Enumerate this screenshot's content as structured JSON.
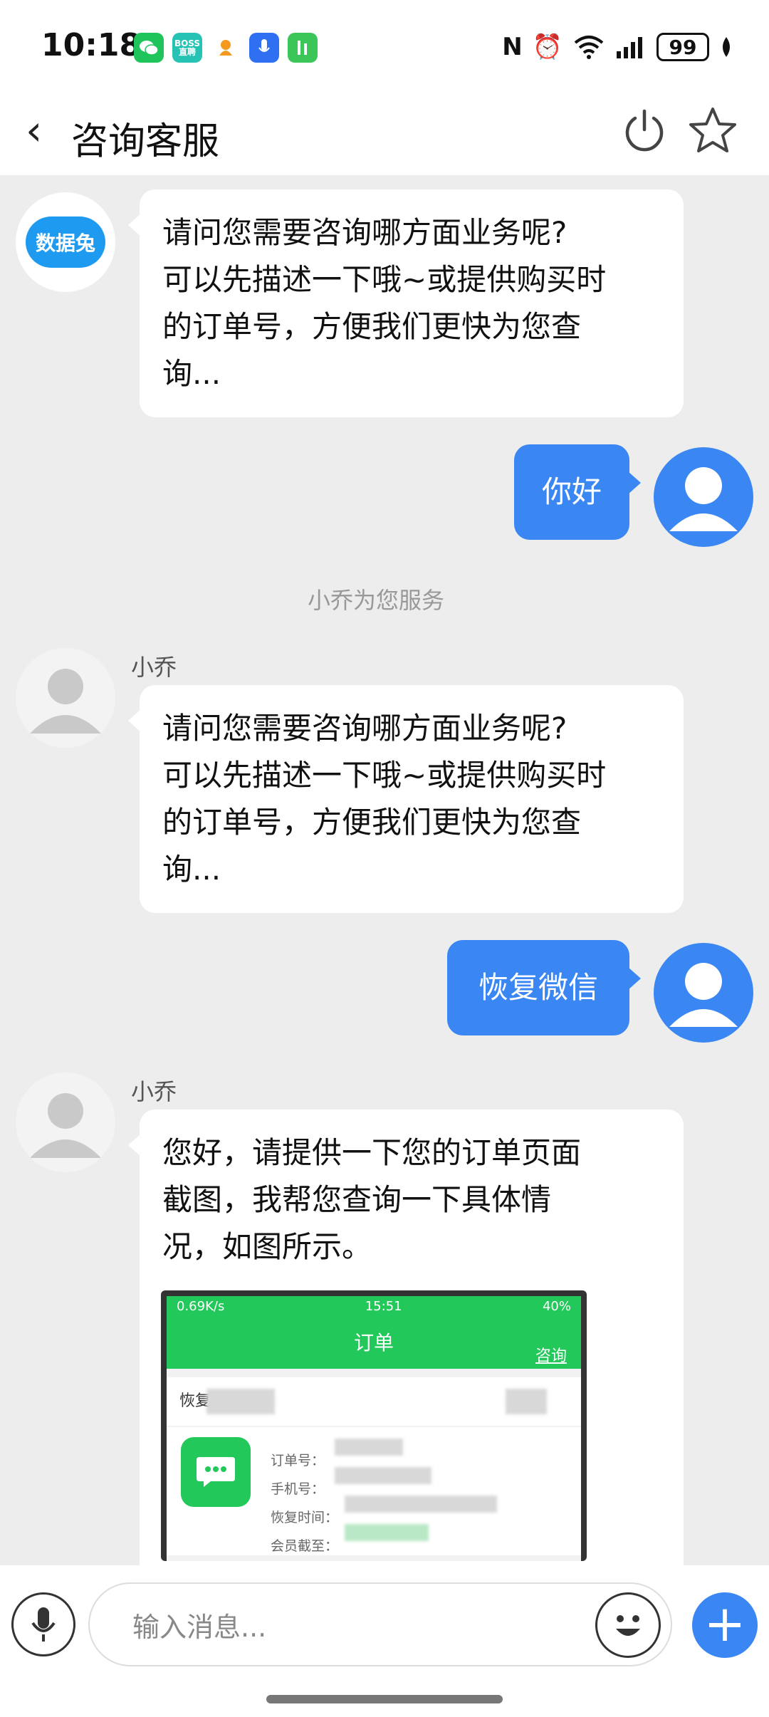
{
  "status_bar": {
    "time": "10:18",
    "app_badges": [
      {
        "name": "wechat-app-icon",
        "label": "",
        "color": "#1fc45a"
      },
      {
        "name": "boss-app-icon",
        "label": "BOSS 直聘",
        "color": "#26c3b5"
      },
      {
        "name": "orange-app-icon",
        "label": "",
        "color": "#ffffff"
      },
      {
        "name": "voice-app-icon",
        "label": "",
        "color": "#2f6ff2"
      },
      {
        "name": "green-app-icon",
        "label": "",
        "color": "#3cc65a"
      }
    ],
    "battery": "99"
  },
  "header": {
    "title": "咨询客服"
  },
  "messages": {
    "bot_logo_text": "数据兔",
    "bot_message": [
      "请问您需要咨询哪方面业务呢?",
      "可以先描述一下哦~或提供购买时",
      "的订单号，方便我们更快为您查",
      "询..."
    ],
    "user_message_1": "你好",
    "system_note": "小乔为您服务",
    "agent_name_1": "小乔",
    "agent_message_1": [
      "请问您需要咨询哪方面业务呢?",
      "可以先描述一下哦~或提供购买时",
      "的订单号，方便我们更快为您查",
      "询..."
    ],
    "user_message_2": "恢复微信",
    "agent_name_2": "小乔",
    "agent_message_2": [
      "您好，请提供一下您的订单页面",
      "截图，我帮您查询一下具体情",
      "况，如图所示。"
    ]
  },
  "example_screenshot": {
    "status_speed": "0.69K/s",
    "status_time": "15:51",
    "status_battery": "40%",
    "title": "订单",
    "consult_link": "咨询",
    "order_label": "恢复",
    "fields": [
      "订单号：",
      "手机号：",
      "恢复时间：",
      "会员截至："
    ]
  },
  "input": {
    "placeholder": "输入消息..."
  },
  "colors": {
    "accent_blue": "#3a86f3",
    "green": "#23c85a",
    "background": "#ededed"
  }
}
